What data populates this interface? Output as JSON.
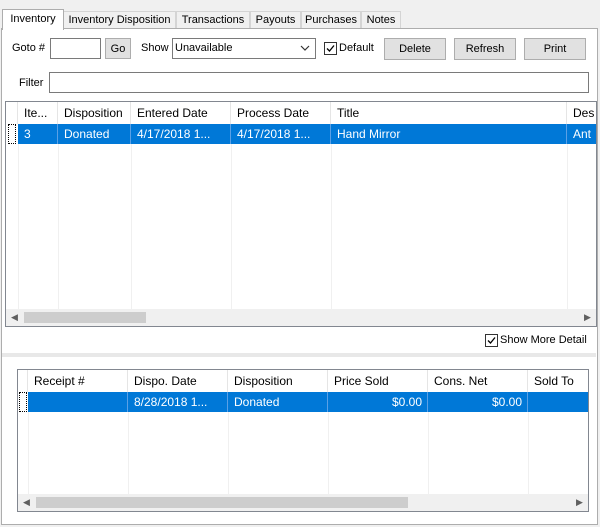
{
  "tabs": [
    {
      "label": "Inventory",
      "active": true
    },
    {
      "label": "Inventory Disposition"
    },
    {
      "label": "Transactions"
    },
    {
      "label": "Payouts"
    },
    {
      "label": "Purchases"
    },
    {
      "label": "Notes"
    }
  ],
  "toolbar": {
    "goto_label": "Goto #",
    "goto_value": "",
    "go_button": "Go",
    "show_label": "Show",
    "show_value": "Unavailable",
    "default_label": "Default",
    "default_checked": true,
    "delete_button": "Delete",
    "refresh_button": "Refresh",
    "print_button": "Print"
  },
  "filter": {
    "label": "Filter",
    "value": ""
  },
  "inventory_grid": {
    "columns": [
      "Ite...",
      "Disposition",
      "Entered Date",
      "Process Date",
      "Title",
      "Des"
    ],
    "rows": [
      [
        "3",
        "Donated",
        "4/17/2018 1...",
        "4/17/2018 1...",
        "Hand Mirror",
        "Ant"
      ]
    ]
  },
  "show_more_detail": {
    "label": "Show More Detail",
    "checked": true
  },
  "disposition_grid": {
    "columns": [
      "Receipt #",
      "Dispo. Date",
      "Disposition",
      "Price Sold",
      "Cons. Net",
      "Sold To"
    ],
    "rows": [
      [
        "",
        "8/28/2018 1...",
        "Donated",
        "$0.00",
        "$0.00",
        ""
      ]
    ]
  },
  "colors": {
    "selection": "#0078d7",
    "border": "#828790",
    "background": "#f0f0f0"
  }
}
